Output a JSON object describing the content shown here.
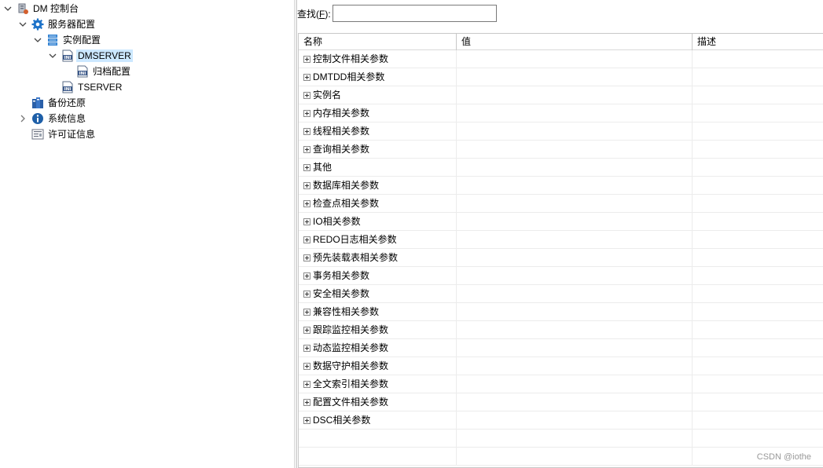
{
  "tree": {
    "root": {
      "label": "DM 控制台",
      "icon": "dm-console-icon"
    },
    "server_config": {
      "label": "服务器配置",
      "icon": "gear-icon"
    },
    "instance_config": {
      "label": "实例配置",
      "icon": "server-stack-icon"
    },
    "dmserver": {
      "label": "DMSERVER",
      "icon": "ini-file-icon",
      "selected": true
    },
    "archive_config": {
      "label": "归档配置",
      "icon": "ini-file-icon"
    },
    "tserver": {
      "label": "TSERVER",
      "icon": "ini-file-icon"
    },
    "backup_restore": {
      "label": "备份还原",
      "icon": "backup-icon"
    },
    "system_info": {
      "label": "系统信息",
      "icon": "info-icon"
    },
    "license_info": {
      "label": "许可证信息",
      "icon": "license-icon"
    }
  },
  "search": {
    "label": "查找(F):",
    "label_prefix": "查找(",
    "label_key": "F",
    "label_suffix": "):",
    "value": ""
  },
  "grid": {
    "columns": [
      "名称",
      "值",
      "描述"
    ],
    "rows": [
      "控制文件相关参数",
      "DMTDD相关参数",
      "实例名",
      "内存相关参数",
      "线程相关参数",
      "查询相关参数",
      "其他",
      "数据库相关参数",
      "检查点相关参数",
      "IO相关参数",
      "REDO日志相关参数",
      "预先装载表相关参数",
      "事务相关参数",
      "安全相关参数",
      "兼容性相关参数",
      "跟踪监控相关参数",
      "动态监控相关参数",
      "数据守护相关参数",
      "全文索引相关参数",
      "配置文件相关参数",
      "DSC相关参数"
    ]
  },
  "watermark": "CSDN @iothe",
  "colors": {
    "selection": "#cce8ff",
    "gear": "#1e73c9",
    "info": "#1e5fa8"
  }
}
